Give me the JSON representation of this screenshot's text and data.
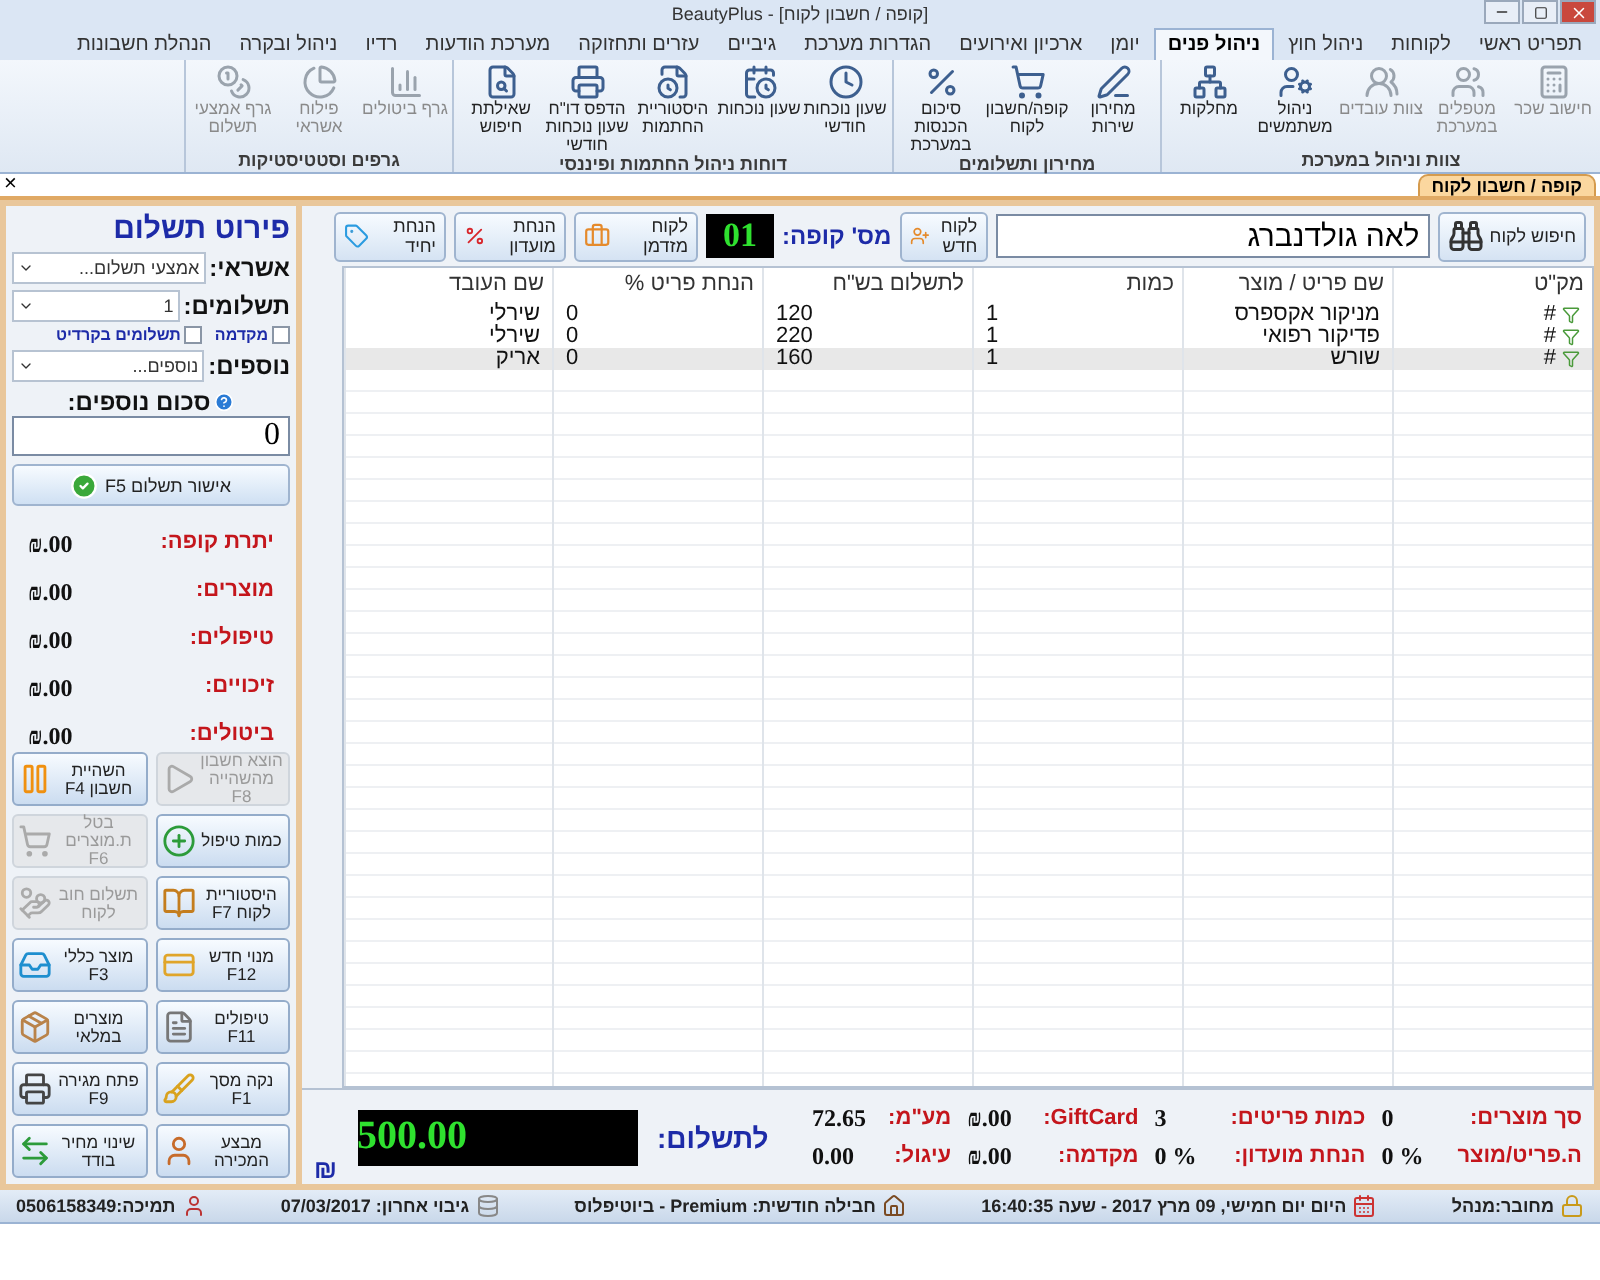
{
  "window": {
    "title": "BeautyPlus - [קופה / חשבון לקוח]"
  },
  "menu_tabs": [
    {
      "label": "תפריט ראשי",
      "selected": false
    },
    {
      "label": "לקוחות",
      "selected": false
    },
    {
      "label": "ניהול חוץ",
      "selected": false
    },
    {
      "label": "ניהול פנים",
      "selected": true
    },
    {
      "label": "יומן",
      "selected": false
    },
    {
      "label": "ארכיון ואירועים",
      "selected": false
    },
    {
      "label": "הגדרות מערכת",
      "selected": false
    },
    {
      "label": "גיביים",
      "selected": false
    },
    {
      "label": "עזרים ותחזוקה",
      "selected": false
    },
    {
      "label": "מערכת הודעות",
      "selected": false
    },
    {
      "label": "רדיו",
      "selected": false
    },
    {
      "label": "ניהול ובקרה",
      "selected": false
    },
    {
      "label": "הנהלת חשבונות",
      "selected": false
    }
  ],
  "ribbon_groups": [
    {
      "title": "צוות וניהול במערכת",
      "buttons": [
        {
          "label": "חישוב שכר",
          "disabled": true
        },
        {
          "label": "מטפלים במערכת",
          "disabled": true
        },
        {
          "label": "צוות עובדים",
          "disabled": true
        },
        {
          "label": "ניהול משתמשים",
          "disabled": false
        },
        {
          "label": "מחלקות",
          "disabled": false
        }
      ]
    },
    {
      "title": "מחירון ותשלומים",
      "buttons": [
        {
          "label": "מחירון שירות",
          "disabled": false
        },
        {
          "label": "קופה/חשבון לקוח",
          "disabled": false
        },
        {
          "label": "סיכום הכנסות במערכת",
          "disabled": false
        }
      ]
    },
    {
      "title": "דוחות ניהול החתמות ופיננסי",
      "buttons": [
        {
          "label": "שעון נוכחות חודשי",
          "disabled": false
        },
        {
          "label": "שעון נוכחות",
          "disabled": false
        },
        {
          "label": "היסטוריית החתמות",
          "disabled": false
        },
        {
          "label": "הדפס דו\"ח שעון נוכחות חודשי",
          "disabled": false
        },
        {
          "label": "שאילתת חיפוש",
          "disabled": false
        }
      ]
    },
    {
      "title": "גרפים וסטטיסטיקות",
      "buttons": [
        {
          "label": "גרף ביטולים",
          "disabled": true
        },
        {
          "label": "פילוח אשראי",
          "disabled": true
        },
        {
          "label": "גרף אמצעי תשלום",
          "disabled": true
        }
      ]
    }
  ],
  "doc_tab": {
    "label": "קופה / חשבון לקוח",
    "close": "×"
  },
  "toolbar": {
    "search_button": "חיפוש לקוח",
    "customer_name": "לאה גולדנברג",
    "new_customer_button": "לקוח חדש",
    "register_label": "מס' קופה:",
    "register_number": "01",
    "buttons": [
      {
        "label": "לקוח מזדמן"
      },
      {
        "label": "הנחת מועדון"
      },
      {
        "label": "הנחת יחיד"
      }
    ]
  },
  "table": {
    "columns": [
      "מק\"ט",
      "שם פריט / מוצר",
      "כמות",
      "לתשלום בש\"ח",
      "הנחת פריט %",
      "שם העובד"
    ],
    "rows": [
      {
        "sku": "#",
        "name": "מניקור אקספרס",
        "qty": "1",
        "price": "120",
        "discount": "0",
        "worker": "שירלי",
        "selected": false
      },
      {
        "sku": "#",
        "name": "פדיקור רפואי",
        "qty": "1",
        "price": "220",
        "discount": "0",
        "worker": "שירלי",
        "selected": false
      },
      {
        "sku": "#",
        "name": "שורש",
        "qty": "1",
        "price": "160",
        "discount": "0",
        "worker": "אריק",
        "selected": true
      }
    ]
  },
  "summary": {
    "total_label": "לתשלום:",
    "total": "500.00",
    "currency": "₪",
    "fields": [
      {
        "label": "סך מוצרים:",
        "value": "0"
      },
      {
        "label": "ה.פריט/מוצר",
        "value": "0 %"
      },
      {
        "label": "כמות פריטים:",
        "value": "3"
      },
      {
        "label": "הנחת מועדון:",
        "value": "0 %"
      },
      {
        "label": "GiftCard:",
        "value": "₪.00"
      },
      {
        "label": "מקדמה:",
        "value": "₪.00"
      },
      {
        "label": "מע\"מ:",
        "value": "72.65"
      },
      {
        "label": "עיגול:",
        "value": "0.00"
      }
    ]
  },
  "payment": {
    "title": "פירוט תשלום",
    "credit_label": "אשראי:",
    "credit_placeholder": "אמצעי תשלום...",
    "installments_label": "תשלומים:",
    "installments_value": "1",
    "checkboxes": [
      {
        "label": "מקדמה",
        "checked": false
      },
      {
        "label": "תשלומים בקרדיט",
        "checked": false
      }
    ],
    "extras_label": "נוספים:",
    "extras_placeholder": "נוספים...",
    "extras_sum_label": "סכום נוספים:",
    "extras_sum_value": "0",
    "confirm_button": "אישור תשלום F5",
    "totals": [
      {
        "label": "יתרת קופה:",
        "value": "₪.00"
      },
      {
        "label": "מוצרים:",
        "value": "₪.00"
      },
      {
        "label": "טיפולים:",
        "value": "₪.00"
      },
      {
        "label": "זיכויים:",
        "value": "₪.00"
      },
      {
        "label": "ביטולים:",
        "value": "₪.00"
      }
    ]
  },
  "action_buttons": [
    {
      "label": "הוצא חשבון מהשהייה F8",
      "disabled": true
    },
    {
      "label": "כמות טיפול",
      "disabled": false
    },
    {
      "label": "היסטוריית לקוח F7",
      "disabled": false
    },
    {
      "label": "מנוי חדש F12",
      "disabled": false
    },
    {
      "label": "טיפולים F11",
      "disabled": false
    },
    {
      "label": "נקה מסך F1",
      "disabled": false
    },
    {
      "label": "מבצע המכירה",
      "disabled": false
    },
    {
      "label": "השהיית חשבון F4",
      "disabled": false
    },
    {
      "label": "בטל ת.מוצרים F6",
      "disabled": true
    },
    {
      "label": "תשלום חוב לקוח",
      "disabled": true
    },
    {
      "label": "מוצר כללי F3",
      "disabled": false
    },
    {
      "label": "מוצרים במלאי",
      "disabled": false
    },
    {
      "label": "פתח מגירה F9",
      "disabled": false
    },
    {
      "label": "שינוי מחיר בודד",
      "disabled": false
    }
  ],
  "status_bar": [
    {
      "text": "מחובר:מנהל"
    },
    {
      "text": "היום יום חמישי, 09 מרץ 2017 - שעה 16:40:35"
    },
    {
      "text": "חבילה חודשית: Premium - ביוטיפלוס"
    },
    {
      "text": "גיבוי אחרון: 07/03/2017"
    },
    {
      "text": "תמיכה:0506158349"
    }
  ]
}
